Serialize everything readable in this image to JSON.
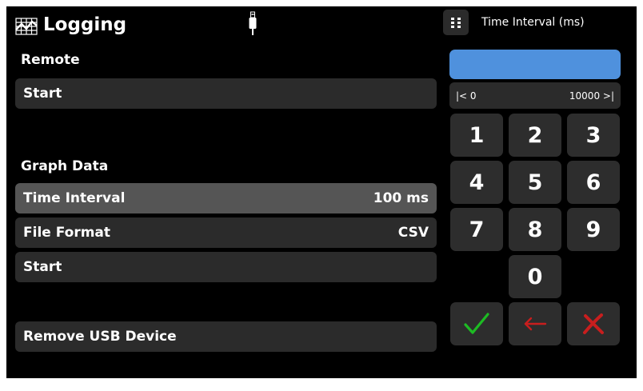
{
  "header": {
    "title": "Logging",
    "logging_icon": "graph-grid-icon",
    "usb_icon": "usb-plug-icon"
  },
  "sections": {
    "remote": {
      "label": "Remote",
      "start_label": "Start"
    },
    "graph_data": {
      "label": "Graph Data",
      "time_interval": {
        "label": "Time Interval",
        "value": "100 ms"
      },
      "file_format": {
        "label": "File Format",
        "value": "CSV"
      },
      "start_label": "Start"
    },
    "remove_usb_label": "Remove USB Device"
  },
  "keypad": {
    "menu_icon": "grid-dots-icon",
    "title": "Time Interval (ms)",
    "input_value": "",
    "range_min": "|< 0",
    "range_max": "10000 >|",
    "keys": [
      "1",
      "2",
      "3",
      "4",
      "5",
      "6",
      "7",
      "8",
      "9",
      "0"
    ],
    "confirm_icon": "checkmark-icon",
    "backspace_icon": "arrow-left-icon",
    "cancel_icon": "x-icon"
  },
  "colors": {
    "background": "#000000",
    "row": "#2b2b2b",
    "row_selected": "#555555",
    "input_accent": "#4f91dd",
    "confirm_green": "#1dbb23",
    "backspace_red": "#c81e1e",
    "cancel_red": "#c81e1e"
  }
}
